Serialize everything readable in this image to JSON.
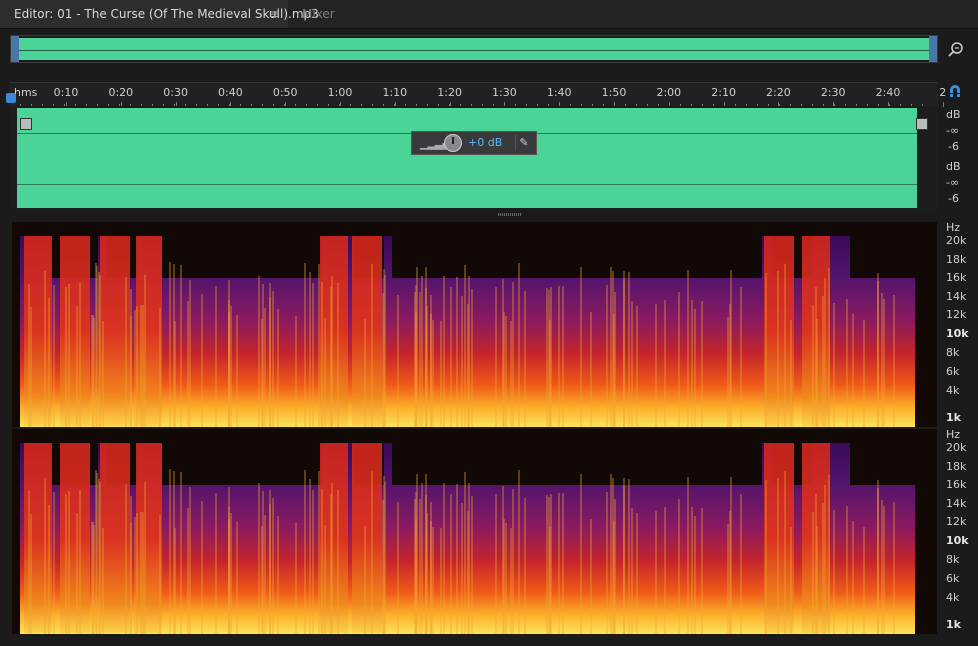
{
  "tabs": {
    "editor_label": "Editor: 01 - The Curse (Of The Medieval Skull).mp3",
    "menu_icon": "≡",
    "mixer_label": "Mixer"
  },
  "ruler": {
    "unit": "hms",
    "labels": [
      "0:10",
      "0:20",
      "0:30",
      "0:40",
      "0:50",
      "1:00",
      "1:10",
      "1:20",
      "1:30",
      "1:40",
      "1:50",
      "2:00",
      "2:10",
      "2:20",
      "2:30",
      "2:40",
      "2"
    ]
  },
  "hud": {
    "gain_value": "+0 dB"
  },
  "db_scale": {
    "ch1": [
      "dB",
      "-∞",
      "-6"
    ],
    "ch2": [
      "dB",
      "-∞",
      "-6"
    ]
  },
  "hz_scale": {
    "unit": "Hz",
    "labels": [
      "20k",
      "18k",
      "16k",
      "14k",
      "12k",
      "10k",
      "8k",
      "6k",
      "4k",
      "1k"
    ]
  },
  "icons": {
    "zoom": "zoom-icon",
    "snap": "snap-magnet-icon",
    "pin": "pin-icon",
    "menu": "menu-icon"
  },
  "colors": {
    "waveform": "#4bd398",
    "accent": "#3d86d6",
    "spectral_hot": "#fde35a",
    "spectral_mid": "#c5252a",
    "spectral_cold": "#3a0b5a"
  }
}
